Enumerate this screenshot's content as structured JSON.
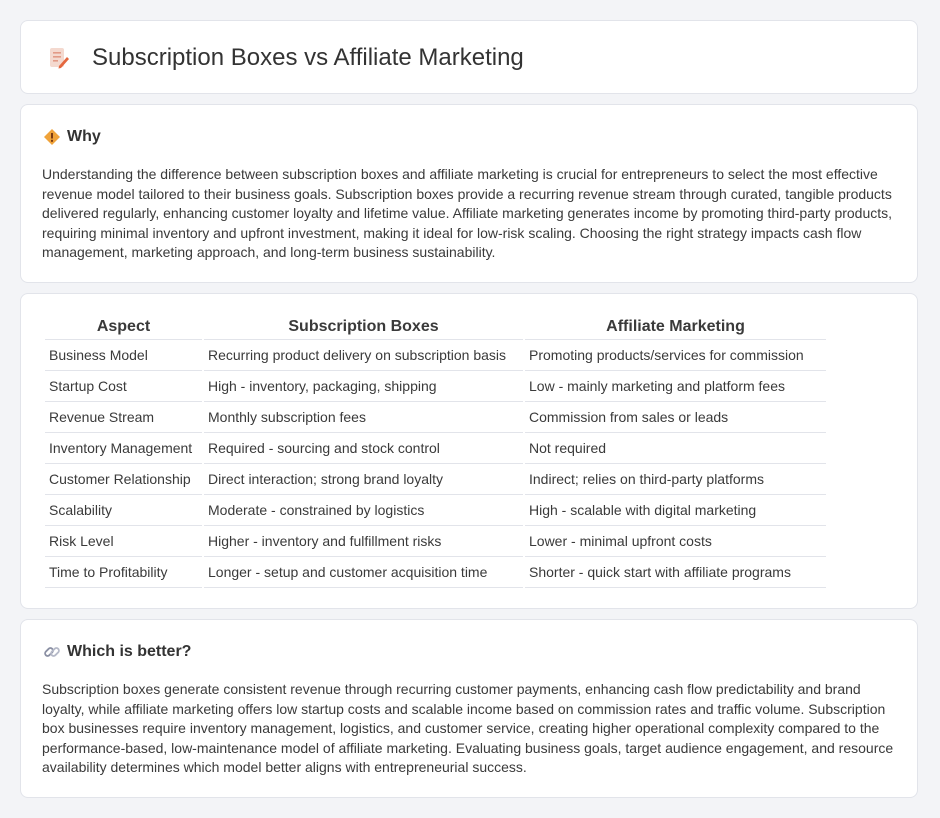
{
  "header": {
    "title": "Subscription Boxes vs Affiliate Marketing",
    "icon": "document-pencil-icon"
  },
  "why": {
    "icon": "diamond-warning-icon",
    "title": "Why",
    "text": "Understanding the difference between subscription boxes and affiliate marketing is crucial for entrepreneurs to select the most effective revenue model tailored to their business goals. Subscription boxes provide a recurring revenue stream through curated, tangible products delivered regularly, enhancing customer loyalty and lifetime value. Affiliate marketing generates income by promoting third-party products, requiring minimal inventory and upfront investment, making it ideal for low-risk scaling. Choosing the right strategy impacts cash flow management, marketing approach, and long-term business sustainability."
  },
  "table": {
    "headers": [
      "Aspect",
      "Subscription Boxes",
      "Affiliate Marketing"
    ],
    "rows": [
      [
        "Business Model",
        "Recurring product delivery on subscription basis",
        "Promoting products/services for commission"
      ],
      [
        "Startup Cost",
        "High - inventory, packaging, shipping",
        "Low - mainly marketing and platform fees"
      ],
      [
        "Revenue Stream",
        "Monthly subscription fees",
        "Commission from sales or leads"
      ],
      [
        "Inventory Management",
        "Required - sourcing and stock control",
        "Not required"
      ],
      [
        "Customer Relationship",
        "Direct interaction; strong brand loyalty",
        "Indirect; relies on third-party platforms"
      ],
      [
        "Scalability",
        "Moderate - constrained by logistics",
        "High - scalable with digital marketing"
      ],
      [
        "Risk Level",
        "Higher - inventory and fulfillment risks",
        "Lower - minimal upfront costs"
      ],
      [
        "Time to Profitability",
        "Longer - setup and customer acquisition time",
        "Shorter - quick start with affiliate programs"
      ]
    ]
  },
  "better": {
    "icon": "link-icon",
    "title": "Which is better?",
    "text": "Subscription boxes generate consistent revenue through recurring customer payments, enhancing cash flow predictability and brand loyalty, while affiliate marketing offers low startup costs and scalable income based on commission rates and traffic volume. Subscription box businesses require inventory management, logistics, and customer service, creating higher operational complexity compared to the performance-based, low-maintenance model of affiliate marketing. Evaluating business goals, target audience engagement, and resource availability determines which model better aligns with entrepreneurial success."
  },
  "colors": {
    "background": "#f3f4f7",
    "card": "#ffffff",
    "border": "#e2e4ea",
    "icon_orange": "#f0a33a",
    "icon_red": "#e45a4a"
  }
}
